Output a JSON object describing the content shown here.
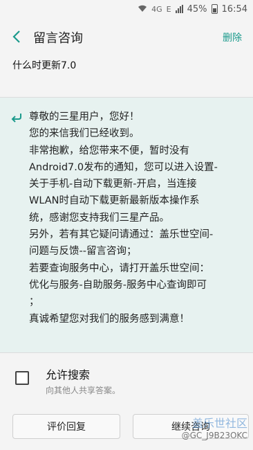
{
  "status_bar": {
    "battery_percent": "45%",
    "time": "16:54",
    "network_labels": [
      "4G",
      "E"
    ]
  },
  "header": {
    "title": "留言咨询",
    "delete_label": "删除"
  },
  "question": {
    "text": "什么时更新7.0"
  },
  "reply": {
    "lines": [
      "尊敬的三星用户，您好！",
      "您的来信我们已经收到。",
      "非常抱歉，给您带来不便，暂时没有",
      "Android7.0发布的通知，您可以进入设置-",
      "关于手机-自动下载更新-开启，当连接",
      "WLAN时自动下载更新最新版本操作系",
      "统，感谢您支持我们三星产品。",
      "另外，若有其它疑问请通过：盖乐世空间-",
      "问题与反馈--留言咨询；",
      "若要查询服务中心，请打开盖乐世空间：",
      "优化与服务-自助服务-服务中心查询即可",
      "；",
      "真诚希望您对我们的服务感到满意！"
    ]
  },
  "allow_search": {
    "title": "允许搜索",
    "subtitle": "向其他人共享答案。",
    "checked": false
  },
  "buttons": {
    "rate_label": "评价回复",
    "continue_label": "继续咨询"
  },
  "watermark": {
    "line1": "盖乐世社区",
    "line2": "@GC_J9B23OKC"
  }
}
